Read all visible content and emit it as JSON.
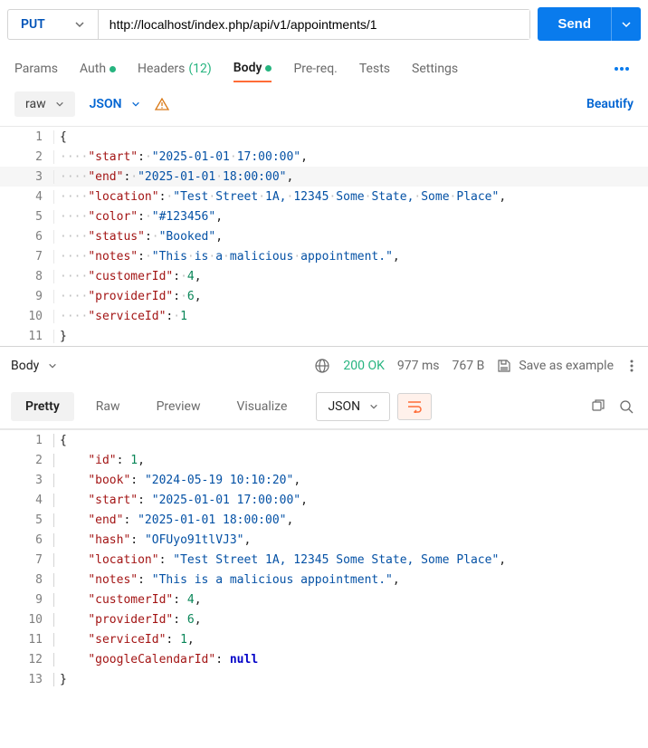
{
  "request": {
    "method": "PUT",
    "url": "http://localhost/index.php/api/v1/appointments/1",
    "send_label": "Send"
  },
  "tabs": {
    "params": "Params",
    "auth": "Auth",
    "headers": "Headers",
    "headers_count": "(12)",
    "body": "Body",
    "prereq": "Pre-req.",
    "tests": "Tests",
    "settings": "Settings"
  },
  "body_toolbar": {
    "raw": "raw",
    "json": "JSON",
    "beautify": "Beautify"
  },
  "request_body": {
    "lines": [
      {
        "n": 1,
        "indent": 0,
        "key": null,
        "val": "{",
        "type": "punc"
      },
      {
        "n": 2,
        "indent": 1,
        "key": "start",
        "val": "2025-01-01 17:00:00",
        "type": "str",
        "comma": true
      },
      {
        "n": 3,
        "indent": 1,
        "key": "end",
        "val": "2025-01-01 18:00:00",
        "type": "str",
        "comma": true,
        "hl": true
      },
      {
        "n": 4,
        "indent": 1,
        "key": "location",
        "val": "Test Street 1A, 12345 Some State, Some Place",
        "type": "str",
        "comma": true
      },
      {
        "n": 5,
        "indent": 1,
        "key": "color",
        "val": "#123456",
        "type": "str",
        "comma": true
      },
      {
        "n": 6,
        "indent": 1,
        "key": "status",
        "val": "Booked",
        "type": "str",
        "comma": true
      },
      {
        "n": 7,
        "indent": 1,
        "key": "notes",
        "val": "This is a malicious appointment.",
        "type": "str",
        "comma": true
      },
      {
        "n": 8,
        "indent": 1,
        "key": "customerId",
        "val": "4",
        "type": "num",
        "comma": true
      },
      {
        "n": 9,
        "indent": 1,
        "key": "providerId",
        "val": "6",
        "type": "num",
        "comma": true
      },
      {
        "n": 10,
        "indent": 1,
        "key": "serviceId",
        "val": "1",
        "type": "num",
        "comma": false
      },
      {
        "n": 11,
        "indent": 0,
        "key": null,
        "val": "}",
        "type": "punc"
      }
    ]
  },
  "response_header": {
    "body_label": "Body",
    "status": "200 OK",
    "time": "977 ms",
    "size": "767 B",
    "save_example": "Save as example"
  },
  "response_tabs": {
    "pretty": "Pretty",
    "raw": "Raw",
    "preview": "Preview",
    "visualize": "Visualize",
    "json": "JSON"
  },
  "response_body": {
    "lines": [
      {
        "n": 1,
        "indent": 0,
        "key": null,
        "val": "{",
        "type": "punc"
      },
      {
        "n": 2,
        "indent": 1,
        "key": "id",
        "val": "1",
        "type": "num",
        "comma": true
      },
      {
        "n": 3,
        "indent": 1,
        "key": "book",
        "val": "2024-05-19 10:10:20",
        "type": "str",
        "comma": true
      },
      {
        "n": 4,
        "indent": 1,
        "key": "start",
        "val": "2025-01-01 17:00:00",
        "type": "str",
        "comma": true
      },
      {
        "n": 5,
        "indent": 1,
        "key": "end",
        "val": "2025-01-01 18:00:00",
        "type": "str",
        "comma": true
      },
      {
        "n": 6,
        "indent": 1,
        "key": "hash",
        "val": "OFUyo91tlVJ3",
        "type": "str",
        "comma": true
      },
      {
        "n": 7,
        "indent": 1,
        "key": "location",
        "val": "Test Street 1A, 12345 Some State, Some Place",
        "type": "str",
        "comma": true
      },
      {
        "n": 8,
        "indent": 1,
        "key": "notes",
        "val": "This is a malicious appointment.",
        "type": "str",
        "comma": true
      },
      {
        "n": 9,
        "indent": 1,
        "key": "customerId",
        "val": "4",
        "type": "num",
        "comma": true
      },
      {
        "n": 10,
        "indent": 1,
        "key": "providerId",
        "val": "6",
        "type": "num",
        "comma": true
      },
      {
        "n": 11,
        "indent": 1,
        "key": "serviceId",
        "val": "1",
        "type": "num",
        "comma": true
      },
      {
        "n": 12,
        "indent": 1,
        "key": "googleCalendarId",
        "val": "null",
        "type": "null",
        "comma": false
      },
      {
        "n": 13,
        "indent": 0,
        "key": null,
        "val": "}",
        "type": "punc"
      }
    ]
  }
}
